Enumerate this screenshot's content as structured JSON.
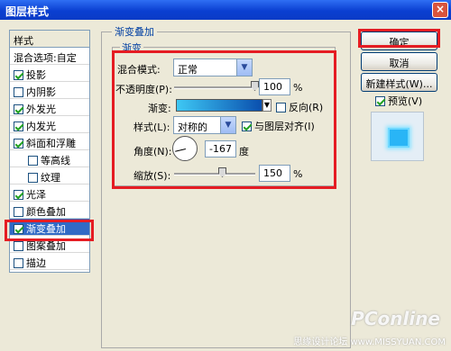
{
  "window": {
    "title": "图层样式",
    "close": "×"
  },
  "styles": {
    "header": "样式",
    "items": [
      {
        "label": "混合选项:自定",
        "checkbox": false,
        "checked": false,
        "indent": false,
        "selected": false
      },
      {
        "label": "投影",
        "checkbox": true,
        "checked": true,
        "indent": false,
        "selected": false
      },
      {
        "label": "内阴影",
        "checkbox": true,
        "checked": false,
        "indent": false,
        "selected": false
      },
      {
        "label": "外发光",
        "checkbox": true,
        "checked": true,
        "indent": false,
        "selected": false
      },
      {
        "label": "内发光",
        "checkbox": true,
        "checked": true,
        "indent": false,
        "selected": false
      },
      {
        "label": "斜面和浮雕",
        "checkbox": true,
        "checked": true,
        "indent": false,
        "selected": false
      },
      {
        "label": "等高线",
        "checkbox": true,
        "checked": false,
        "indent": true,
        "selected": false
      },
      {
        "label": "纹理",
        "checkbox": true,
        "checked": false,
        "indent": true,
        "selected": false
      },
      {
        "label": "光泽",
        "checkbox": true,
        "checked": true,
        "indent": false,
        "selected": false
      },
      {
        "label": "颜色叠加",
        "checkbox": true,
        "checked": false,
        "indent": false,
        "selected": false
      },
      {
        "label": "渐变叠加",
        "checkbox": true,
        "checked": true,
        "indent": false,
        "selected": true
      },
      {
        "label": "图案叠加",
        "checkbox": true,
        "checked": false,
        "indent": false,
        "selected": false
      },
      {
        "label": "描边",
        "checkbox": true,
        "checked": false,
        "indent": false,
        "selected": false
      }
    ]
  },
  "panel": {
    "title": "渐变叠加",
    "subtitle": "渐变",
    "blend_mode_label": "混合模式:",
    "blend_mode_value": "正常",
    "opacity_label": "不透明度(P):",
    "opacity_value": "100",
    "opacity_unit": "%",
    "opacity_level": 1.0,
    "gradient_label": "渐变:",
    "gradient_colors": [
      "#3ec8f4",
      "#0a4fae"
    ],
    "reverse_label": "反向(R)",
    "reverse_checked": false,
    "style_label": "样式(L):",
    "style_value": "对称的",
    "align_label": "与图层对齐(I)",
    "align_checked": true,
    "angle_label": "角度(N):",
    "angle_value": "-167",
    "angle_unit": "度",
    "scale_label": "缩放(S):",
    "scale_value": "150",
    "scale_unit": "%",
    "scale_level": 0.6
  },
  "buttons": {
    "ok": "确定",
    "cancel": "取消",
    "new_style": "新建样式(W)...",
    "preview_label": "预览(V)",
    "preview_checked": true
  },
  "watermark": {
    "brand": "PConline",
    "text": "思缘设计论坛 www.MISSYUAN.COM"
  }
}
